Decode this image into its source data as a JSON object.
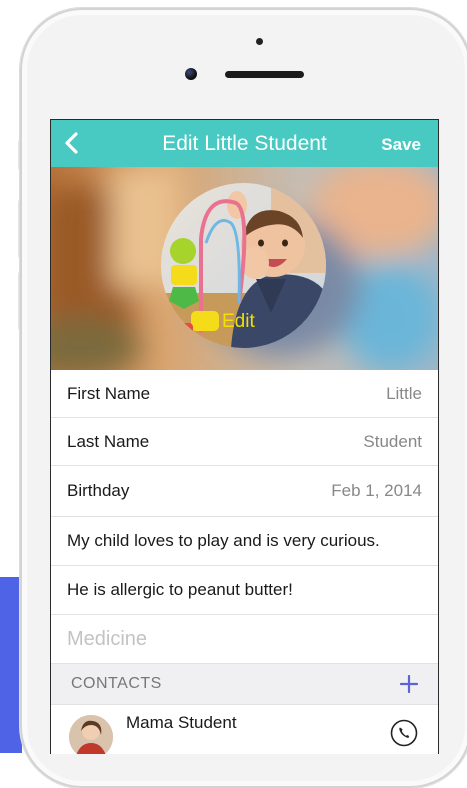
{
  "navbar": {
    "title": "Edit Little Student",
    "save_label": "Save"
  },
  "hero": {
    "edit_label": "Edit"
  },
  "form": {
    "first_name": {
      "label": "First Name",
      "value": "Little"
    },
    "last_name": {
      "label": "Last Name",
      "value": "Student"
    },
    "birthday": {
      "label": "Birthday",
      "value": "Feb 1, 2014"
    },
    "note1": "My child loves to play and is very curious.",
    "note2": "He is allergic to peanut butter!",
    "medicine_placeholder": "Medicine"
  },
  "contacts": {
    "header": "CONTACTS",
    "items": [
      {
        "name": "Mama Student"
      }
    ]
  },
  "colors": {
    "accent": "#48c9c1",
    "edit_text": "#f1e000",
    "background_accent": "#4f63e6"
  },
  "icons": {
    "back": "chevron-left-icon",
    "add": "plus-icon",
    "call": "phone-icon"
  }
}
